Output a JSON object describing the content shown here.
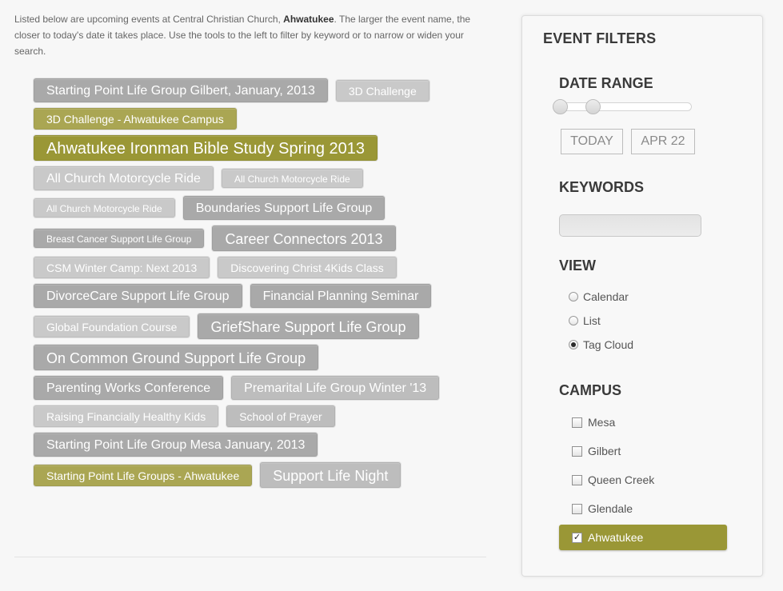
{
  "intro": {
    "text_before": "Listed below are upcoming events at Central Christian Church, ",
    "campus_bold": "Ahwatukee",
    "text_after": ". The larger the event name, the closer to today's date it takes place. Use the tools to the left to filter by keyword or to narrow or widen your search."
  },
  "events": [
    [
      "Starting Point Life Group Gilbert, January, 2013",
      "3D Challenge"
    ],
    [
      "3D Challenge - Ahwatukee Campus"
    ],
    [
      "Ahwatukee Ironman Bible Study Spring 2013"
    ],
    [
      "All Church Motorcycle Ride",
      "All Church Motorcycle Ride"
    ],
    [
      "All Church Motorcycle Ride",
      "Boundaries Support Life Group"
    ],
    [
      "Breast Cancer Support Life Group",
      "Career Connectors 2013"
    ],
    [
      "CSM Winter Camp: Next 2013",
      "Discovering Christ 4Kids Class"
    ],
    [
      "DivorceCare Support Life Group",
      "Financial Planning Seminar"
    ],
    [
      "Global Foundation Course",
      "GriefShare Support Life Group"
    ],
    [
      "On Common Ground Support Life Group"
    ],
    [
      "Parenting Works Conference",
      "Premarital Life Group Winter '13"
    ],
    [
      "Raising Financially Healthy Kids",
      "School of Prayer"
    ],
    [
      "Starting Point Life Group Mesa January, 2013"
    ],
    [
      "Starting Point Life Groups - Ahwatukee",
      "Support Life Night"
    ]
  ],
  "filters": {
    "title": "EVENT FILTERS",
    "date_range": {
      "heading": "DATE RANGE",
      "start_label": "TODAY",
      "end_label": "APR 22"
    },
    "keywords": {
      "heading": "KEYWORDS",
      "value": "",
      "placeholder": ""
    },
    "view": {
      "heading": "VIEW",
      "options": [
        "Calendar",
        "List",
        "Tag Cloud"
      ],
      "selected": "Tag Cloud"
    },
    "campus": {
      "heading": "CAMPUS",
      "options": [
        "Mesa",
        "Gilbert",
        "Queen Creek",
        "Glendale",
        "Ahwatukee"
      ],
      "checked": "Ahwatukee"
    }
  },
  "colors": {
    "accent_olive": "#9a9736",
    "accent_olive_light": "#aaa653",
    "tag_gray_dark": "#a9a9a9",
    "tag_gray_mid": "#bdbdbd",
    "tag_gray_light": "#c9c9c9"
  },
  "icons": {
    "checkbox_checked": "check-mark-icon"
  }
}
